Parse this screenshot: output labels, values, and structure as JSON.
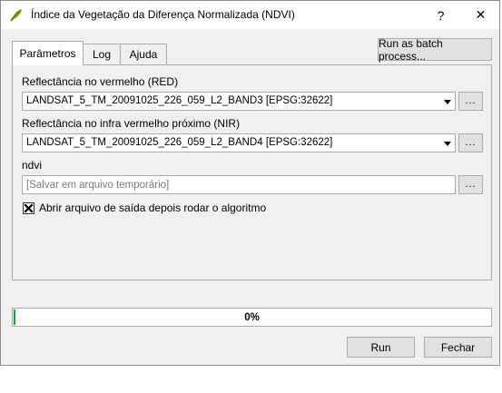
{
  "window": {
    "title": "Índice da Vegetação da Diferença Normalizada (NDVI)",
    "help_glyph": "?",
    "close_glyph": "✕",
    "app_icon": "qgis-leaf-icon"
  },
  "tabs": [
    {
      "label": "Parâmetros",
      "active": true
    },
    {
      "label": "Log",
      "active": false
    },
    {
      "label": "Ajuda",
      "active": false
    }
  ],
  "batch_button": {
    "label": "Run as batch process..."
  },
  "params": {
    "red": {
      "label": "Reflectância no vermelho (RED)",
      "value": "LANDSAT_5_TM_20091025_226_059_L2_BAND3 [EPSG:32622]",
      "browse_label": "..."
    },
    "nir": {
      "label": "Reflectância no infra vermelho próximo (NIR)",
      "value": "LANDSAT_5_TM_20091025_226_059_L2_BAND4 [EPSG:32622]",
      "browse_label": "..."
    },
    "ndvi": {
      "label": "ndvi",
      "value": "",
      "placeholder": "[Salvar em arquivo temporário]",
      "browse_label": "..."
    },
    "open_output": {
      "label": "Abrir arquivo de saída depois rodar o algoritmo",
      "checked": true
    }
  },
  "progress": {
    "value": 0.0,
    "text": "0%",
    "color": "#06b025"
  },
  "buttons": {
    "run": "Run",
    "close": "Fechar"
  }
}
